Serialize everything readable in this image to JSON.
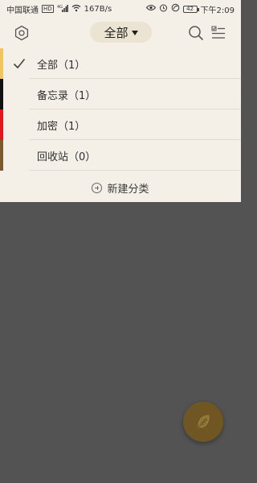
{
  "status_bar": {
    "carrier": "中国联通",
    "hd_badge": "HD",
    "signal_label": "4G",
    "speed": "167B/s",
    "battery": "42",
    "time": "下午2:09"
  },
  "header": {
    "title": "全部"
  },
  "categories": [
    {
      "label": "全部（1）",
      "color": "#f3c55c",
      "selected": true
    },
    {
      "label": "备忘录（1）",
      "color": "#111111",
      "selected": false
    },
    {
      "label": "加密（1）",
      "color": "#e8141d",
      "selected": false
    },
    {
      "label": "回收站（0）",
      "color": "#7a5a2e",
      "selected": false
    }
  ],
  "new_category_label": "新建分类",
  "colors": {
    "panel_bg": "#f4f0e8",
    "overlay": "#545353",
    "pill": "#ebe4d2",
    "fab": "#6f5622"
  },
  "icons": [
    "settings-icon",
    "search-icon",
    "checklist-icon",
    "check-icon",
    "plus-circle-icon",
    "feather-icon"
  ]
}
